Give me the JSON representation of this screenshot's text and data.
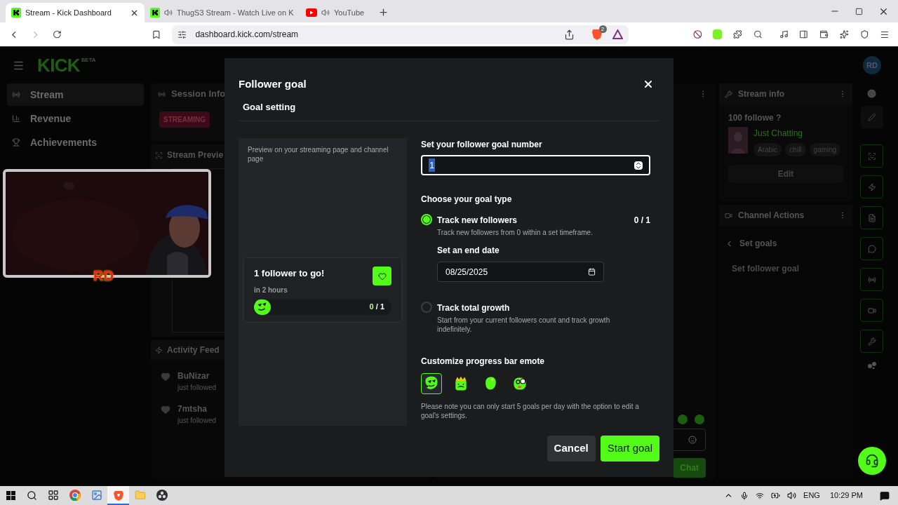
{
  "browser": {
    "tabs": [
      {
        "title": "Stream - Kick Dashboard",
        "selected": true,
        "audio": false,
        "kind": "kick"
      },
      {
        "title": "ThugS3 Stream - Watch Live on K",
        "selected": false,
        "audio": true,
        "kind": "kick"
      },
      {
        "title": "YouTube",
        "selected": false,
        "audio": true,
        "kind": "youtube"
      }
    ],
    "address": "dashboard.kick.com/stream",
    "shield_count": "2"
  },
  "dashboard": {
    "logo": "KICK",
    "logo_badge": "BETA",
    "avatar": "RD",
    "nav": [
      {
        "label": "Stream",
        "selected": true
      },
      {
        "label": "Revenue",
        "selected": false
      },
      {
        "label": "Achievements",
        "selected": false
      }
    ],
    "session_info": {
      "title": "Session Info",
      "status": "STREAMING"
    },
    "stream_preview": {
      "title": "Stream Previe"
    },
    "activity_feed": {
      "title": "Activity Feed",
      "items": [
        {
          "name": "BuNizar",
          "action": "just followed"
        },
        {
          "name": "7mtsha",
          "action": "just followed"
        }
      ]
    },
    "chat": {
      "send": "Chat"
    },
    "stream_info": {
      "title": "Stream info",
      "stream_title": "100 followe ?",
      "category": "Just Chatting",
      "tags": [
        "Arabic",
        "chill",
        "gaming"
      ],
      "edit": "Edit"
    },
    "channel_actions": {
      "title": "Channel Actions",
      "back": "Set goals",
      "item": "Set follower goal"
    }
  },
  "webcam": {
    "caption": "RD"
  },
  "modal": {
    "title": "Follower goal",
    "section": "Goal setting",
    "preview_caption": "Preview on your streaming page and channel page",
    "preview_card": {
      "title": "1 follower to go!",
      "subtitle": "in 2 hours",
      "current": "0",
      "total": "/ 1",
      "level": 0
    },
    "goal_number": {
      "label": "Set your follower goal number",
      "value": "1"
    },
    "goal_type": {
      "label": "Choose your goal type",
      "options": [
        {
          "label": "Track new followers",
          "description": "Track new followers from 0 within a set timeframe.",
          "selected": true,
          "count": "0 / 1",
          "end_date_label": "Set an end date",
          "end_date": "08/25/2025"
        },
        {
          "label": "Track total growth",
          "description": "Start from your current followers count and track growth indefinitely.",
          "selected": false
        }
      ]
    },
    "emote": {
      "label": "Customize progress bar emote",
      "emotes": [
        {
          "kind": "sunglasses",
          "selected": true
        },
        {
          "kind": "crown",
          "selected": false
        },
        {
          "kind": "plain",
          "selected": false
        },
        {
          "kind": "monocle",
          "selected": false
        }
      ]
    },
    "note": "Please note you can only start 5 goals per day with the option to edit a goal's settings.",
    "cancel": "Cancel",
    "start": "Start goal"
  },
  "taskbar": {
    "apps": [
      {
        "kind": "taskview",
        "selected": false
      },
      {
        "kind": "chrome",
        "selected": false
      },
      {
        "kind": "photos",
        "selected": false
      },
      {
        "kind": "brave",
        "selected": true
      },
      {
        "kind": "files",
        "selected": false
      },
      {
        "kind": "obs",
        "selected": false
      }
    ],
    "language": "ENG",
    "time": "10:29 PM"
  }
}
